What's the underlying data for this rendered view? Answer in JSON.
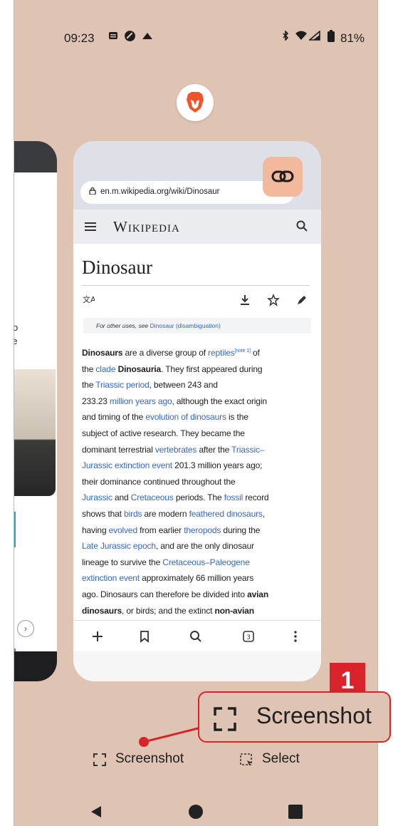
{
  "status_bar": {
    "time": "09:23",
    "battery": "81%"
  },
  "browser": {
    "url": "en.m.wikipedia.org/wiki/Dinosaur",
    "site_logo": "Wikipedia",
    "article_title": "Dinosaur",
    "hatnote_prefix": "For other uses, see ",
    "hatnote_link": "Dinosaur (disambiguation)"
  },
  "left_card": {
    "text_line1": "o",
    "text_line2": "de"
  },
  "callout": {
    "badge_number": "1",
    "label": "Screenshot"
  },
  "actions": {
    "screenshot_label": "Screenshot",
    "select_label": "Select"
  },
  "colors": {
    "background": "#dfc4b4",
    "accent": "#d8232a",
    "link": "#3366cc",
    "link_button": "#f2b99c"
  },
  "icons": [
    "brave-lion-icon",
    "link-icon",
    "menu-icon",
    "search-icon",
    "language-icon",
    "download-icon",
    "star-icon",
    "edit-icon",
    "plus-icon",
    "bookmark-icon",
    "tabs-icon",
    "more-icon",
    "screenshot-icon",
    "select-icon",
    "back-icon",
    "home-icon",
    "recents-icon"
  ]
}
